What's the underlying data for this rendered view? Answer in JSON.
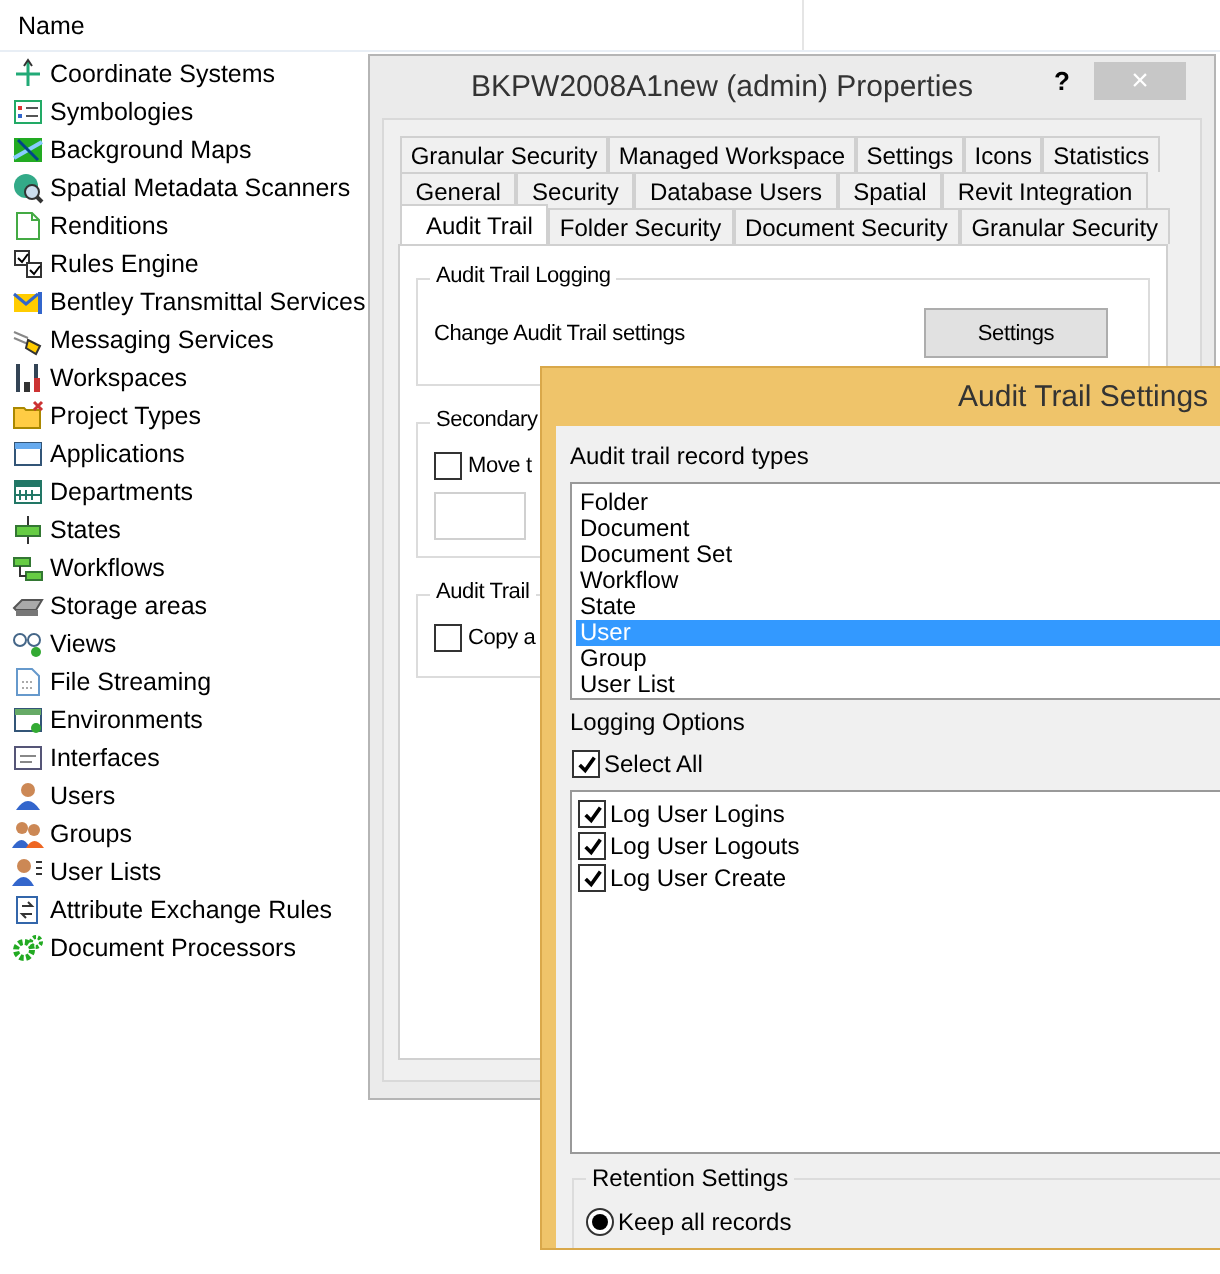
{
  "tree": {
    "header": "Name",
    "items": [
      {
        "label": "Coordinate Systems"
      },
      {
        "label": "Symbologies"
      },
      {
        "label": "Background Maps"
      },
      {
        "label": "Spatial Metadata Scanners"
      },
      {
        "label": "Renditions"
      },
      {
        "label": "Rules Engine"
      },
      {
        "label": "Bentley Transmittal Services"
      },
      {
        "label": "Messaging Services"
      },
      {
        "label": "Workspaces"
      },
      {
        "label": "Project Types"
      },
      {
        "label": "Applications"
      },
      {
        "label": "Departments"
      },
      {
        "label": "States"
      },
      {
        "label": "Workflows"
      },
      {
        "label": "Storage areas"
      },
      {
        "label": "Views"
      },
      {
        "label": "File Streaming"
      },
      {
        "label": "Environments"
      },
      {
        "label": "Interfaces"
      },
      {
        "label": "Users"
      },
      {
        "label": "Groups"
      },
      {
        "label": "User Lists"
      },
      {
        "label": "Attribute Exchange Rules"
      },
      {
        "label": "Document Processors"
      }
    ]
  },
  "properties_dialog": {
    "title": "BKPW2008A1new (admin) Properties",
    "help": "?",
    "close": "×",
    "tab_rows": [
      [
        {
          "label": "Granular Security",
          "selected": false
        },
        {
          "label": "Managed Workspace",
          "selected": false
        },
        {
          "label": "Settings",
          "selected": false
        },
        {
          "label": "Icons",
          "selected": false
        },
        {
          "label": "Statistics",
          "selected": false
        }
      ],
      [
        {
          "label": "General",
          "selected": false
        },
        {
          "label": "Security",
          "selected": false
        },
        {
          "label": "Database Users",
          "selected": false
        },
        {
          "label": "Spatial",
          "selected": false
        },
        {
          "label": "Revit Integration",
          "selected": false
        }
      ],
      [
        {
          "label": "Audit Trail",
          "selected": true
        },
        {
          "label": "Folder Security",
          "selected": false
        },
        {
          "label": "Document Security",
          "selected": false
        },
        {
          "label": "Granular Security",
          "selected": false
        }
      ]
    ],
    "logging_group": {
      "title": "Audit Trail Logging",
      "text": "Change Audit Trail settings",
      "button": "Settings"
    },
    "secondary_group": {
      "title": "Secondary",
      "checkbox": {
        "label": "Move t",
        "checked": false
      }
    },
    "group_3": {
      "title": "Audit Trail",
      "checkbox": {
        "label": "Copy a",
        "checked": false
      }
    }
  },
  "settings_dialog": {
    "title": "Audit Trail Settings",
    "record_types_label": "Audit trail record types",
    "record_types": [
      {
        "label": "Folder",
        "selected": false
      },
      {
        "label": "Document",
        "selected": false
      },
      {
        "label": "Document Set",
        "selected": false
      },
      {
        "label": "Workflow",
        "selected": false
      },
      {
        "label": "State",
        "selected": false
      },
      {
        "label": "User",
        "selected": true
      },
      {
        "label": "Group",
        "selected": false
      },
      {
        "label": "User List",
        "selected": false
      }
    ],
    "logging_options_label": "Logging Options",
    "select_all": {
      "label": "Select All",
      "checked": true
    },
    "options": [
      {
        "label": "Log User Logins",
        "checked": true
      },
      {
        "label": "Log User Logouts",
        "checked": true
      },
      {
        "label": "Log User Create",
        "checked": true
      }
    ],
    "retention": {
      "title": "Retention Settings",
      "options": [
        {
          "label": "Keep all records",
          "selected": true
        }
      ]
    }
  }
}
